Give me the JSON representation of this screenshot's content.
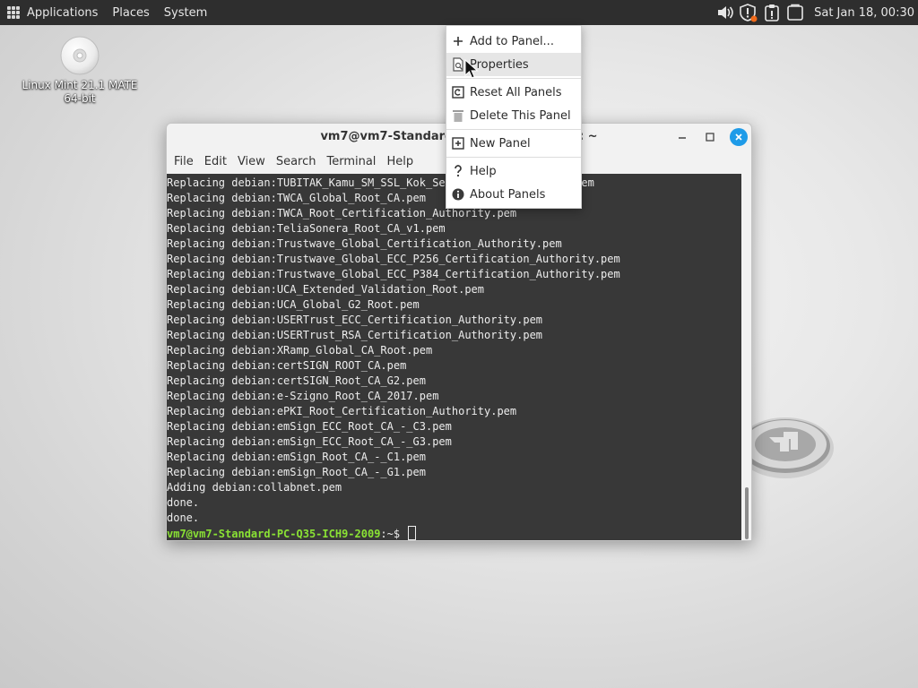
{
  "top_panel": {
    "applications_label": "Applications",
    "places_label": "Places",
    "system_label": "System",
    "tray_icons": [
      "volume-icon",
      "shield-update-icon",
      "clipboard-alert-icon",
      "window-list-icon"
    ],
    "clock": "Sat Jan 18, 00:30"
  },
  "desktop": {
    "disc_label_line1": "Linux Mint 21.1 MATE",
    "disc_label_line2": "64-bit"
  },
  "terminal": {
    "title": "vm7@vm7-Standard-PC-Q35-ICH9-2009: ~",
    "menu": [
      "File",
      "Edit",
      "View",
      "Search",
      "Terminal",
      "Help"
    ],
    "lines": [
      "Replacing debian:TUBITAK_Kamu_SM_SSL_Kok_Sertifikasi_-_Surum_1.pem",
      "Replacing debian:TWCA_Global_Root_CA.pem",
      "Replacing debian:TWCA_Root_Certification_Authority.pem",
      "Replacing debian:TeliaSonera_Root_CA_v1.pem",
      "Replacing debian:Trustwave_Global_Certification_Authority.pem",
      "Replacing debian:Trustwave_Global_ECC_P256_Certification_Authority.pem",
      "Replacing debian:Trustwave_Global_ECC_P384_Certification_Authority.pem",
      "Replacing debian:UCA_Extended_Validation_Root.pem",
      "Replacing debian:UCA_Global_G2_Root.pem",
      "Replacing debian:USERTrust_ECC_Certification_Authority.pem",
      "Replacing debian:USERTrust_RSA_Certification_Authority.pem",
      "Replacing debian:XRamp_Global_CA_Root.pem",
      "Replacing debian:certSIGN_ROOT_CA.pem",
      "Replacing debian:certSIGN_Root_CA_G2.pem",
      "Replacing debian:e-Szigno_Root_CA_2017.pem",
      "Replacing debian:ePKI_Root_Certification_Authority.pem",
      "Replacing debian:emSign_ECC_Root_CA_-_C3.pem",
      "Replacing debian:emSign_ECC_Root_CA_-_G3.pem",
      "Replacing debian:emSign_Root_CA_-_C1.pem",
      "Replacing debian:emSign_Root_CA_-_G1.pem",
      "Adding debian:collabnet.pem",
      "done.",
      "done."
    ],
    "prompt_user": "vm7@vm7-Standard-PC-Q35-ICH9-2009",
    "prompt_suffix": ":~$ "
  },
  "context_menu": {
    "items": [
      {
        "label": "Add to Panel...",
        "icon": "plus-icon"
      },
      {
        "label": "Properties",
        "icon": "properties-icon"
      },
      {
        "label": "Reset All Panels",
        "icon": "reset-icon"
      },
      {
        "label": "Delete This Panel",
        "icon": "trash-icon"
      },
      {
        "label": "New Panel",
        "icon": "new-panel-icon"
      },
      {
        "label": "Help",
        "icon": "help-icon"
      },
      {
        "label": "About Panels",
        "icon": "info-icon"
      }
    ]
  },
  "colors": {
    "panel_bg": "#2e2e2e",
    "terminal_bg": "#383838",
    "prompt_green": "#8ae234",
    "close_blue": "#1e9be8"
  }
}
